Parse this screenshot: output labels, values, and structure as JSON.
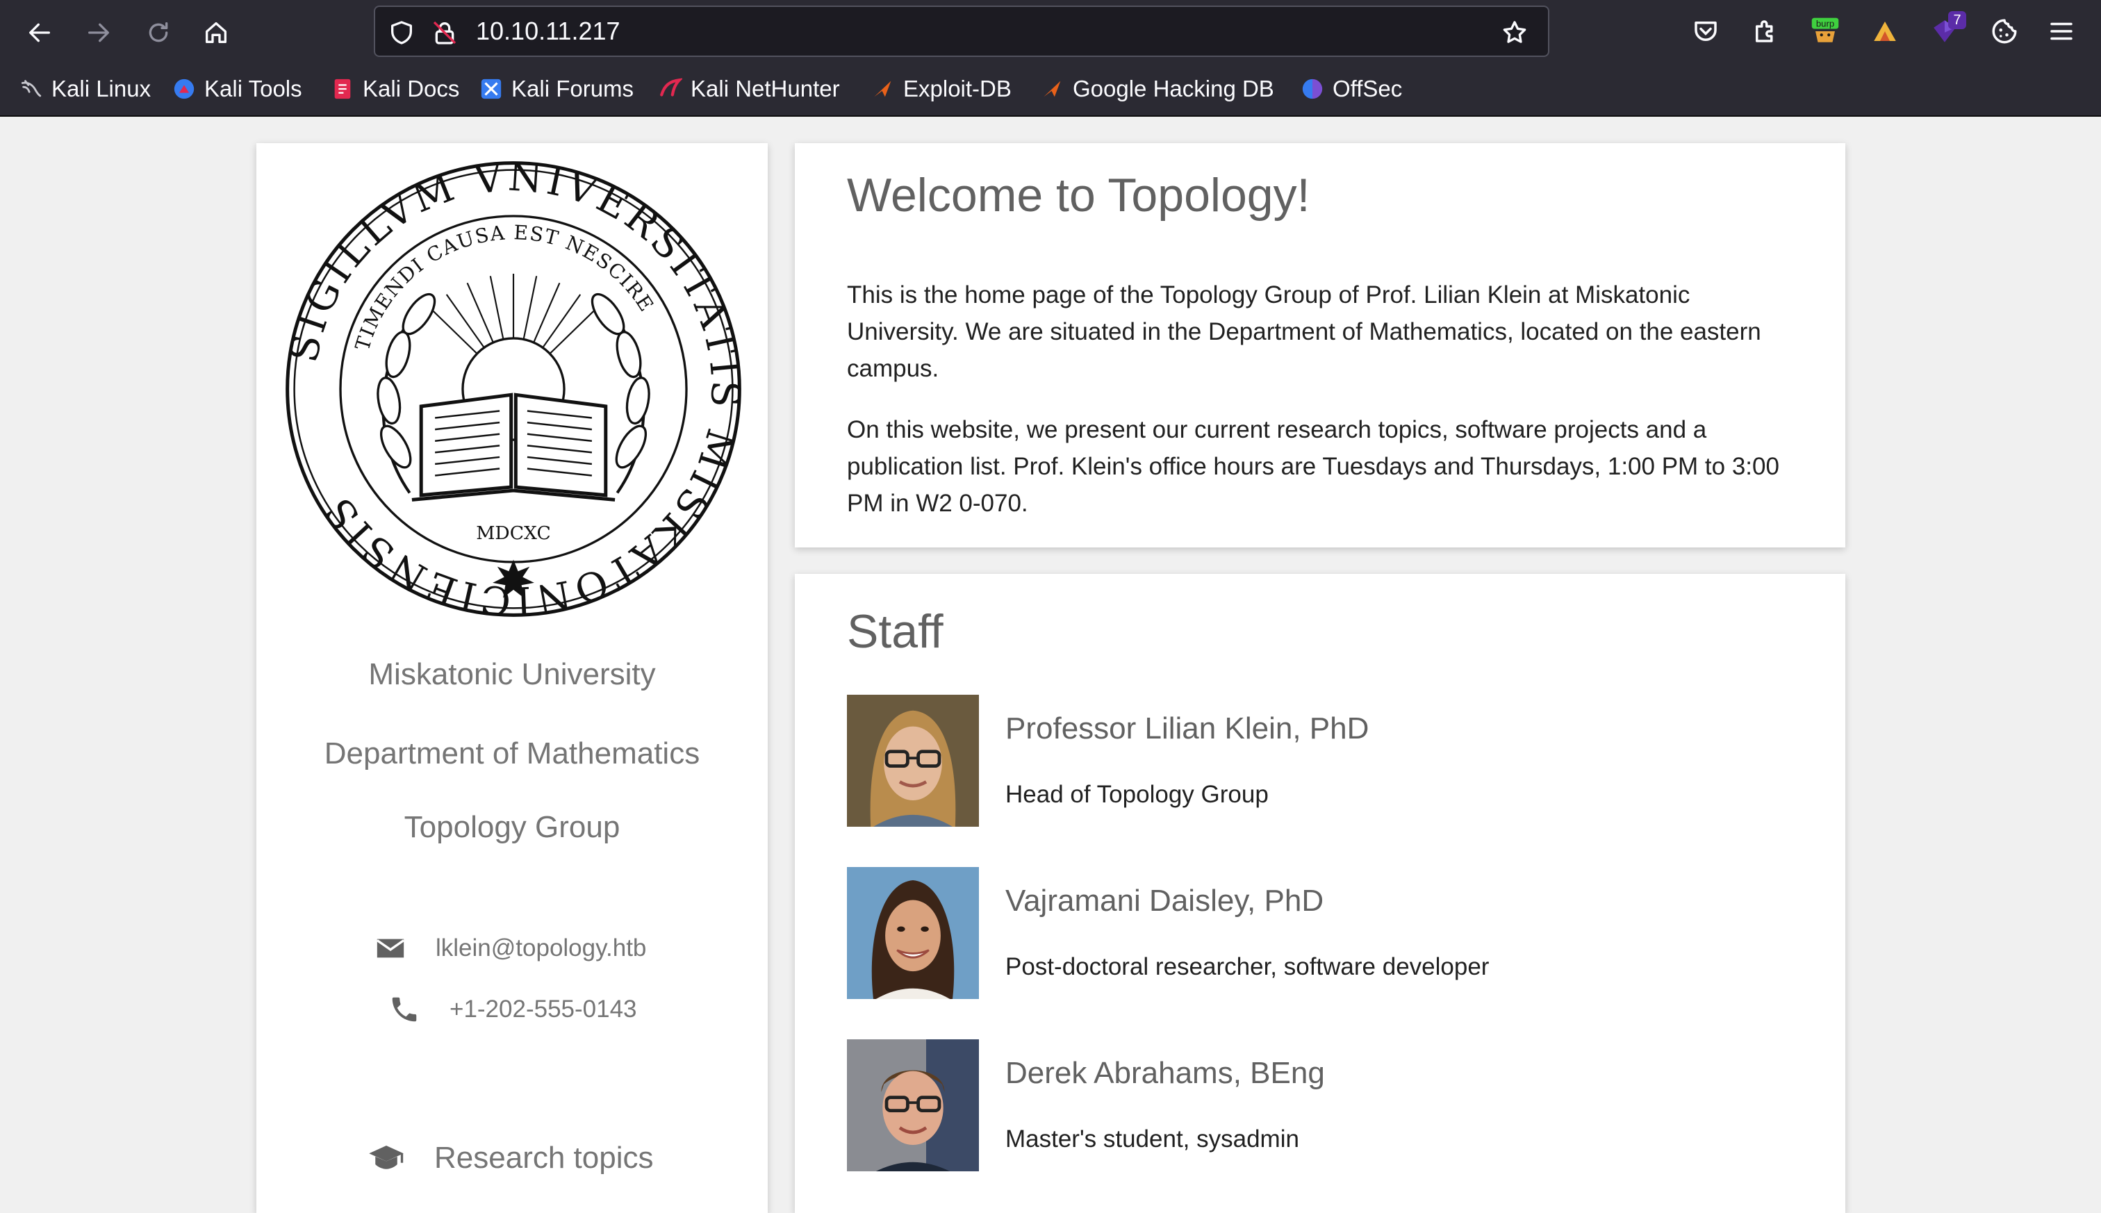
{
  "browser": {
    "url": "10.10.11.217",
    "extensions": [
      "pocket-icon",
      "extensions-icon",
      "burp-icon",
      "wappalyzer-icon",
      "foxyproxy-icon",
      "cookie-icon",
      "menu-icon"
    ],
    "burp_label": "burp",
    "notification_count": "7",
    "bookmarks": [
      {
        "label": "Kali Linux"
      },
      {
        "label": "Kali Tools"
      },
      {
        "label": "Kali Docs"
      },
      {
        "label": "Kali Forums"
      },
      {
        "label": "Kali NetHunter"
      },
      {
        "label": "Exploit-DB"
      },
      {
        "label": "Google Hacking DB"
      },
      {
        "label": "OffSec"
      }
    ]
  },
  "sidebar": {
    "seal_text": {
      "outer": "SIGILLVM VNIVERSITATIS MISKATONICIENSIS",
      "inner": "TIMENDI CAUSA EST NESCIRE",
      "year": "MDCXC"
    },
    "university": "Miskatonic University",
    "department": "Department of Mathematics",
    "group": "Topology Group",
    "email": "lklein@topology.htb",
    "phone": "+1-202-555-0143",
    "nav_research": "Research topics"
  },
  "welcome": {
    "title": "Welcome to Topology!",
    "paragraphs": [
      "This is the home page of the Topology Group of Prof. Lilian Klein at Miskatonic University. We are situated in the Department of Mathematics, located on the eastern campus.",
      "On this website, we present our current research topics, software projects and a publication list. Prof. Klein's office hours are Tuesdays and Thursdays, 1:00 PM to 3:00 PM in W2 0-070."
    ]
  },
  "staff": {
    "title": "Staff",
    "members": [
      {
        "name": "Professor Lilian Klein, PhD",
        "role": "Head of Topology Group"
      },
      {
        "name": "Vajramani Daisley, PhD",
        "role": "Post-doctoral researcher, software developer"
      },
      {
        "name": "Derek Abrahams, BEng",
        "role": "Master's student, sysadmin"
      }
    ]
  },
  "colors": {
    "browser_toolbar": "#2b2a33",
    "page_background": "#f0f0f0",
    "heading": "#616161",
    "muted_text": "#757575"
  }
}
